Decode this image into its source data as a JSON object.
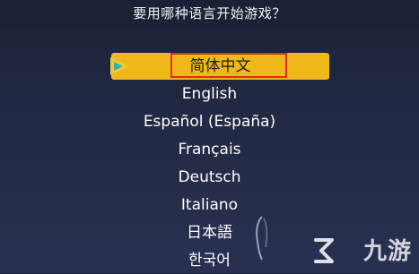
{
  "prompt": "要用哪种语言开始游戏？",
  "languages": [
    {
      "label": "简体中文",
      "selected": true
    },
    {
      "label": "English",
      "selected": false
    },
    {
      "label": "Español (España)",
      "selected": false
    },
    {
      "label": "Français",
      "selected": false
    },
    {
      "label": "Deutsch",
      "selected": false
    },
    {
      "label": "Italiano",
      "selected": false
    },
    {
      "label": "日本語",
      "selected": false
    },
    {
      "label": "한국어",
      "selected": false
    }
  ],
  "watermark": {
    "text": "九游",
    "icon": "jiuyou-logo-icon"
  },
  "colors": {
    "highlight": "#f0b81a",
    "focus_border": "#e02b22",
    "cursor": "#f3c93a",
    "cursor_inner": "#2bb6a8"
  }
}
